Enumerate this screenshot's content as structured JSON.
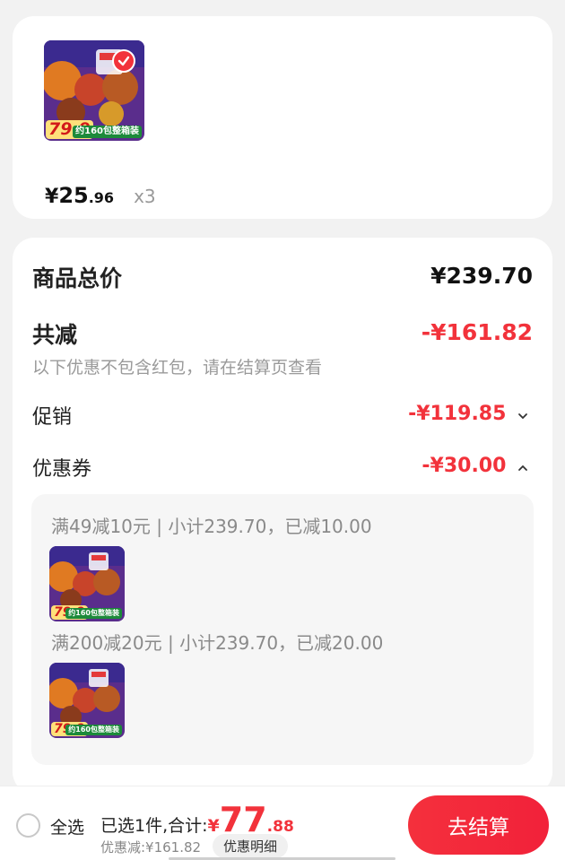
{
  "item": {
    "thumb_promo": "79.9",
    "thumb_pack": "约160包整箱装",
    "price_yen": "¥",
    "price_int": "25",
    "price_dec": ".96",
    "quantity": "x3",
    "selected": true
  },
  "summary": {
    "total_label": "商品总价",
    "total_value": "¥239.70",
    "reduce_label": "共减",
    "reduce_value": "-¥161.82",
    "reduce_note": "以下优惠不包含红包，请在结算页查看",
    "promo_label": "促销",
    "promo_value": "-¥119.85",
    "coupon_label": "优惠券",
    "coupon_value": "-¥30.00"
  },
  "coupons": [
    {
      "text": "满49减10元 | 小计239.70，已减10.00"
    },
    {
      "text": "满200减20元 | 小计239.70，已减20.00"
    }
  ],
  "bottom": {
    "select_all": "全选",
    "total_prefix": "已选1件,合计:",
    "total_yen": "¥",
    "total_int": "77",
    "total_dec": ".88",
    "discount_text": "优惠减:¥161.82",
    "detail_button": "优惠明细",
    "checkout_button": "去结算"
  },
  "colors": {
    "accent_red": "#f2323b",
    "background": "#f2f2f2",
    "panel": "#f6f6f6"
  }
}
